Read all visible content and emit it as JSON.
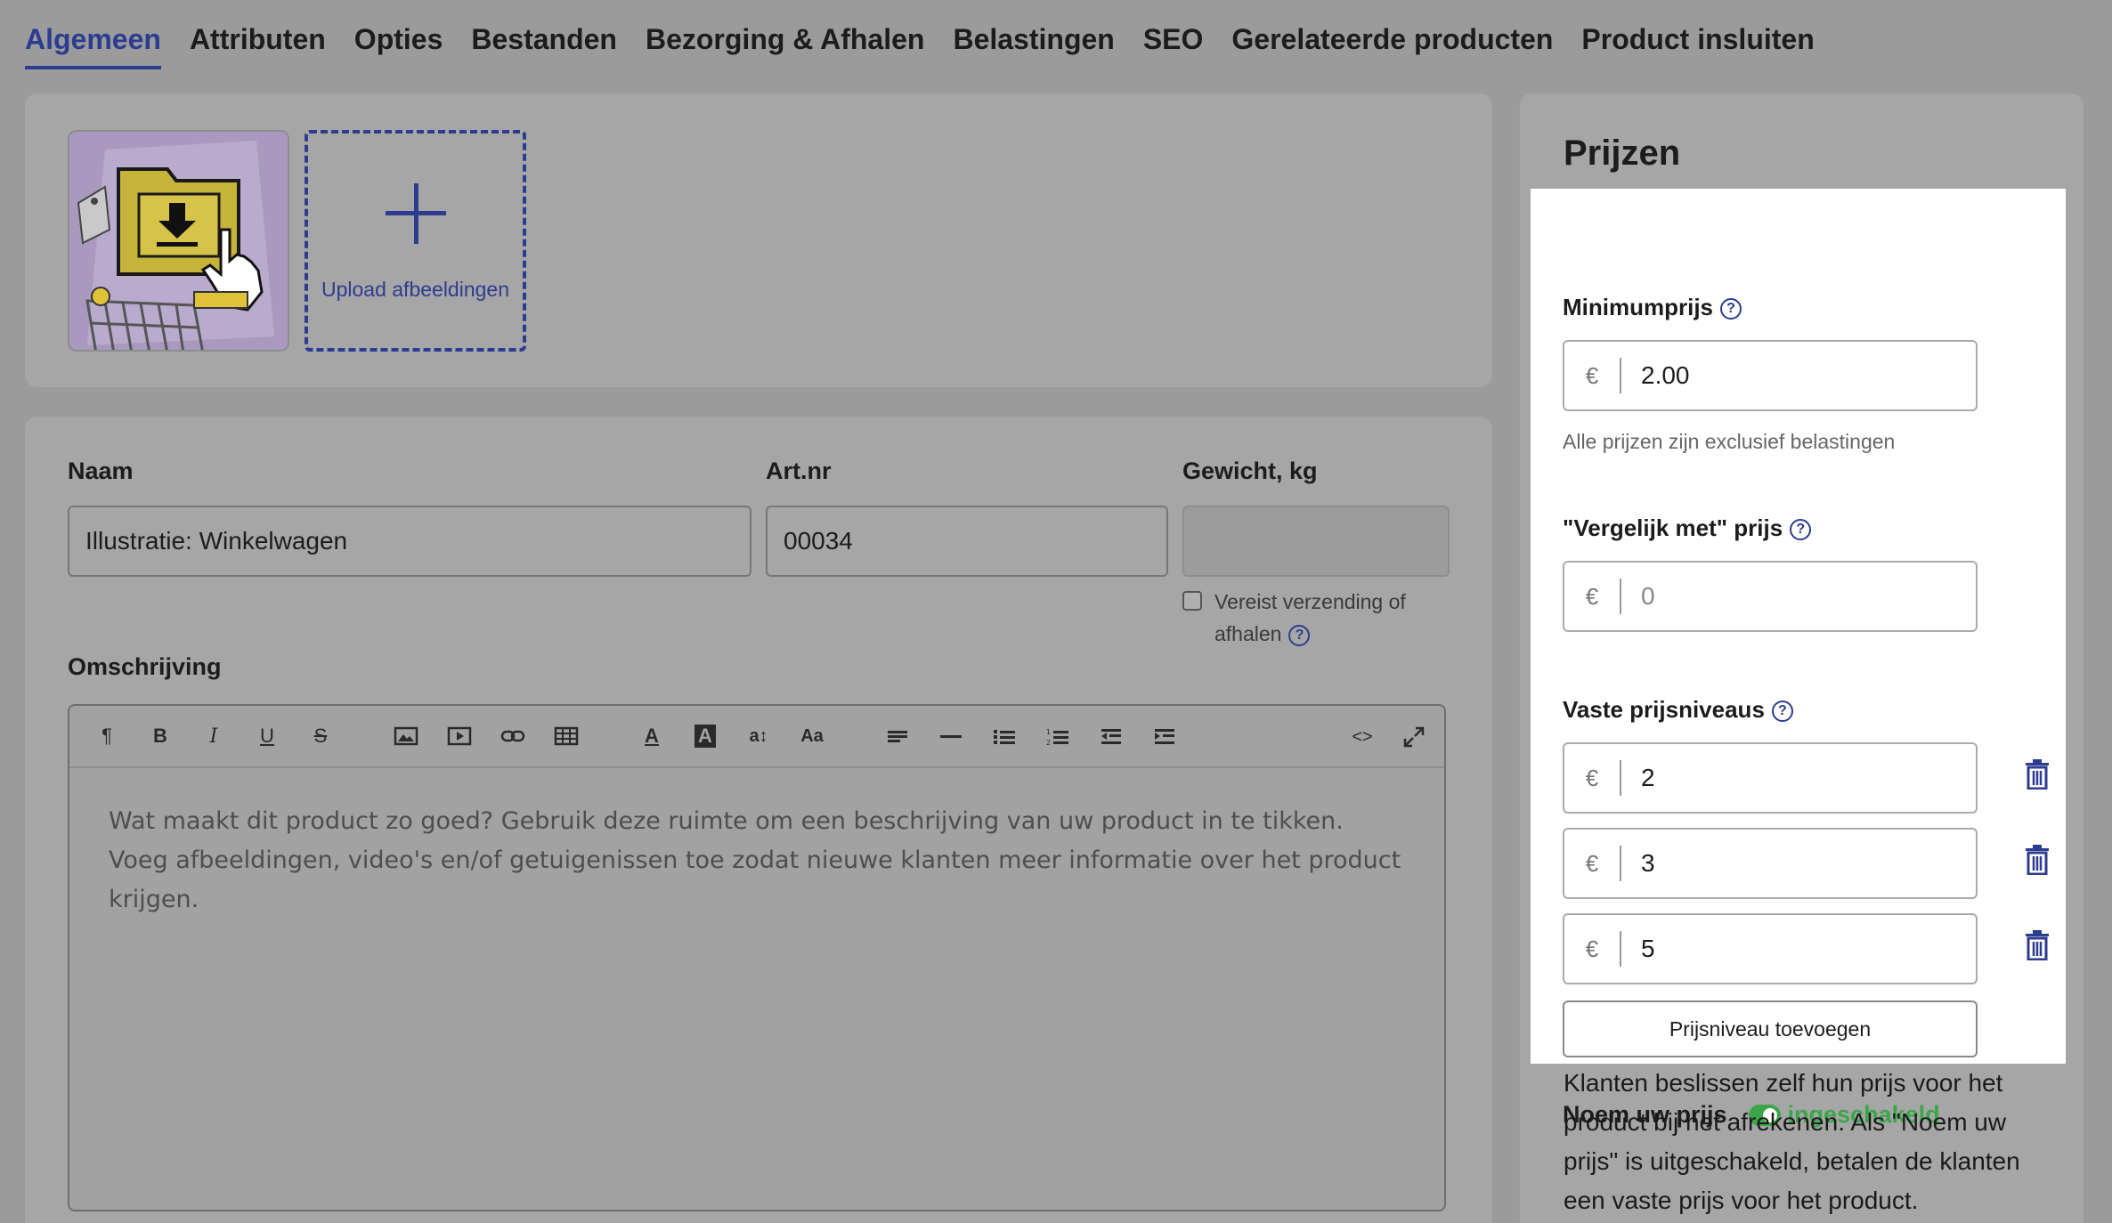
{
  "tabs": [
    {
      "label": "Algemeen",
      "active": true
    },
    {
      "label": "Attributen"
    },
    {
      "label": "Opties"
    },
    {
      "label": "Bestanden"
    },
    {
      "label": "Bezorging & Afhalen"
    },
    {
      "label": "Belastingen"
    },
    {
      "label": "SEO"
    },
    {
      "label": "Gerelateerde producten"
    },
    {
      "label": "Product insluiten"
    }
  ],
  "images": {
    "upload_label": "Upload afbeeldingen",
    "thumbnail_icon": "shopping-cart-folder-illustration"
  },
  "details": {
    "name_label": "Naam",
    "name_value": "Illustratie: Winkelwagen",
    "sku_label": "Art.nr",
    "sku_value": "00034",
    "weight_label": "Gewicht, kg",
    "weight_value": "",
    "shipping_checkbox_label": "Vereist verzending of afhalen",
    "shipping_checked": false,
    "description_label": "Omschrijving",
    "description_placeholder": "Wat maakt dit product zo goed? Gebruik deze ruimte om een beschrijving van uw product in te tikken. Voeg afbeeldingen, video's en/of getuigenissen toe zodat nieuwe klanten meer informatie over het product krijgen."
  },
  "editor_toolbar": [
    "paragraph-icon",
    "bold-icon",
    "italic-icon",
    "underline-icon",
    "strikethrough-icon",
    "image-icon",
    "video-icon",
    "link-icon",
    "table-icon",
    "text-color-icon",
    "background-color-icon",
    "line-height-icon",
    "font-size-icon",
    "align-icon",
    "horizontal-rule-icon",
    "bullet-list-icon",
    "numbered-list-icon",
    "outdent-icon",
    "indent-icon",
    "code-view-icon",
    "fullscreen-icon"
  ],
  "prices": {
    "title": "Prijzen",
    "currency": "€",
    "min_price_label": "Minimumprijs",
    "min_price_value": "2.00",
    "tax_hint": "Alle prijzen zijn exclusief belastingen",
    "compare_label": "\"Vergelijk met\" prijs",
    "compare_placeholder": "0",
    "levels_label": "Vaste prijsniveaus",
    "levels": [
      "2",
      "3",
      "5"
    ],
    "add_level_label": "Prijsniveau toevoegen",
    "pwyw_label": "Noem uw prijs",
    "pwyw_status": "ingeschakeld",
    "pwyw_enabled": true,
    "description": "Klanten beslissen zelf hun prijs voor het product bij het afrekenen. Als \"Noem uw prijs\" is uitgeschakeld, betalen de klanten een vaste prijs voor het product."
  },
  "colors": {
    "accent": "#2c3c8f",
    "enabled_green": "#3ca64a",
    "overlay_gray": "#9b9b9b"
  }
}
